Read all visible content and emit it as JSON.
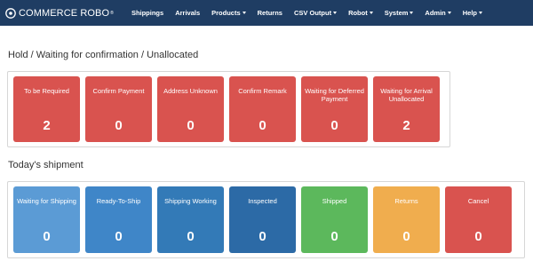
{
  "navbar": {
    "brand": "COMMERCE ROBO",
    "brand_mark": "®",
    "items": [
      {
        "label": "Shippings",
        "dropdown": false
      },
      {
        "label": "Arrivals",
        "dropdown": false
      },
      {
        "label": "Products",
        "dropdown": true
      },
      {
        "label": "Returns",
        "dropdown": false
      },
      {
        "label": "CSV Output",
        "dropdown": true
      },
      {
        "label": "Robot",
        "dropdown": true
      },
      {
        "label": "System",
        "dropdown": true
      },
      {
        "label": "Admin",
        "dropdown": true
      },
      {
        "label": "Help",
        "dropdown": true
      }
    ],
    "colors": {
      "background": "#1f3d63"
    }
  },
  "hold_section": {
    "title": "Hold / Waiting for confirmation / Unallocated",
    "tiles": [
      {
        "label": "To be Required",
        "count": "2",
        "color": "#d9534f"
      },
      {
        "label": "Confirm Payment",
        "count": "0",
        "color": "#d9534f"
      },
      {
        "label": "Address Unknown",
        "count": "0",
        "color": "#d9534f"
      },
      {
        "label": "Confirm Remark",
        "count": "0",
        "color": "#d9534f"
      },
      {
        "label": "Waiting for Deferred Payment",
        "count": "0",
        "color": "#d9534f"
      },
      {
        "label": "Waiting for Arrival Unallocated",
        "count": "2",
        "color": "#d9534f"
      }
    ]
  },
  "today_section": {
    "title": "Today's shipment",
    "tiles": [
      {
        "label": "Waiting for Shipping",
        "count": "0",
        "color": "#5b9bd5"
      },
      {
        "label": "Ready-To-Ship",
        "count": "0",
        "color": "#3f86c8"
      },
      {
        "label": "Shipping Working",
        "count": "0",
        "color": "#337ab7"
      },
      {
        "label": "Inspected",
        "count": "0",
        "color": "#2c6aa6"
      },
      {
        "label": "Shipped",
        "count": "0",
        "color": "#5cb85c"
      },
      {
        "label": "Returns",
        "count": "0",
        "color": "#f0ad4e"
      },
      {
        "label": "Cancel",
        "count": "0",
        "color": "#d9534f"
      }
    ]
  }
}
